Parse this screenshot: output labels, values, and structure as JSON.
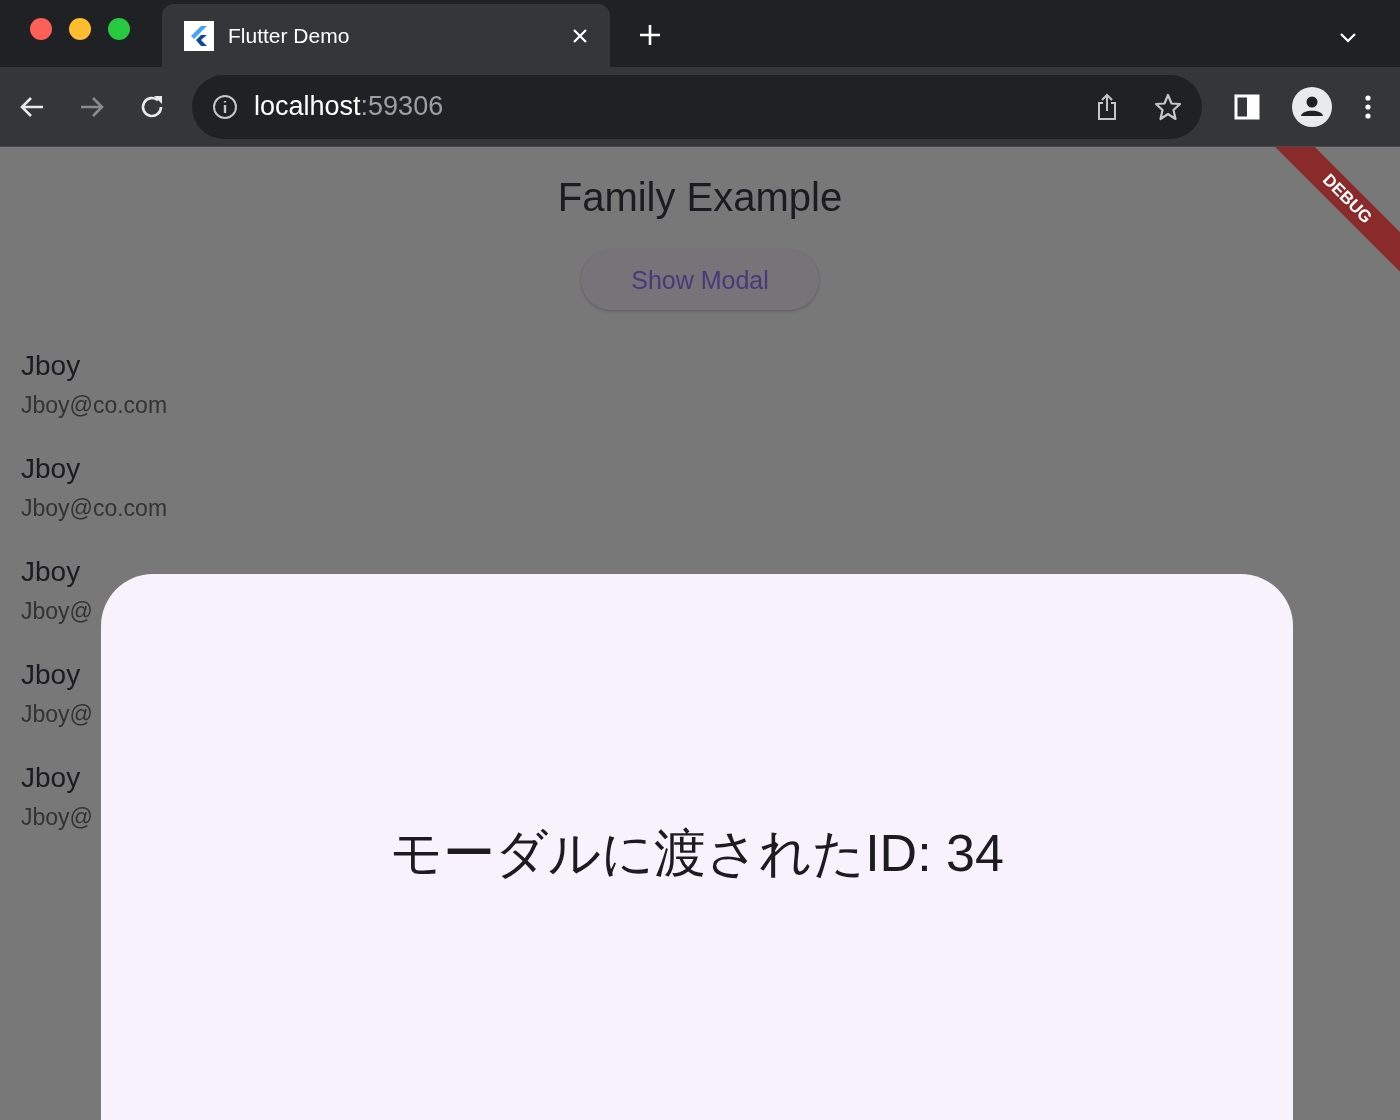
{
  "browser": {
    "tabs": [
      {
        "title": "Flutter Demo",
        "selected": true
      }
    ],
    "address": {
      "host": "localhost",
      "rest": ":59306"
    }
  },
  "page": {
    "title": "Family Example",
    "button": "Show Modal",
    "debug_banner": "DEBUG",
    "people": [
      {
        "name": "Jboy",
        "email": "Jboy@co.com"
      },
      {
        "name": "Jboy",
        "email": "Jboy@co.com"
      },
      {
        "name": "Jboy",
        "email": "Jboy@"
      },
      {
        "name": "Jboy",
        "email": "Jboy@"
      },
      {
        "name": "Jboy",
        "email": "Jboy@"
      }
    ]
  },
  "modal": {
    "text": "モーダルに渡されたID: 34"
  }
}
